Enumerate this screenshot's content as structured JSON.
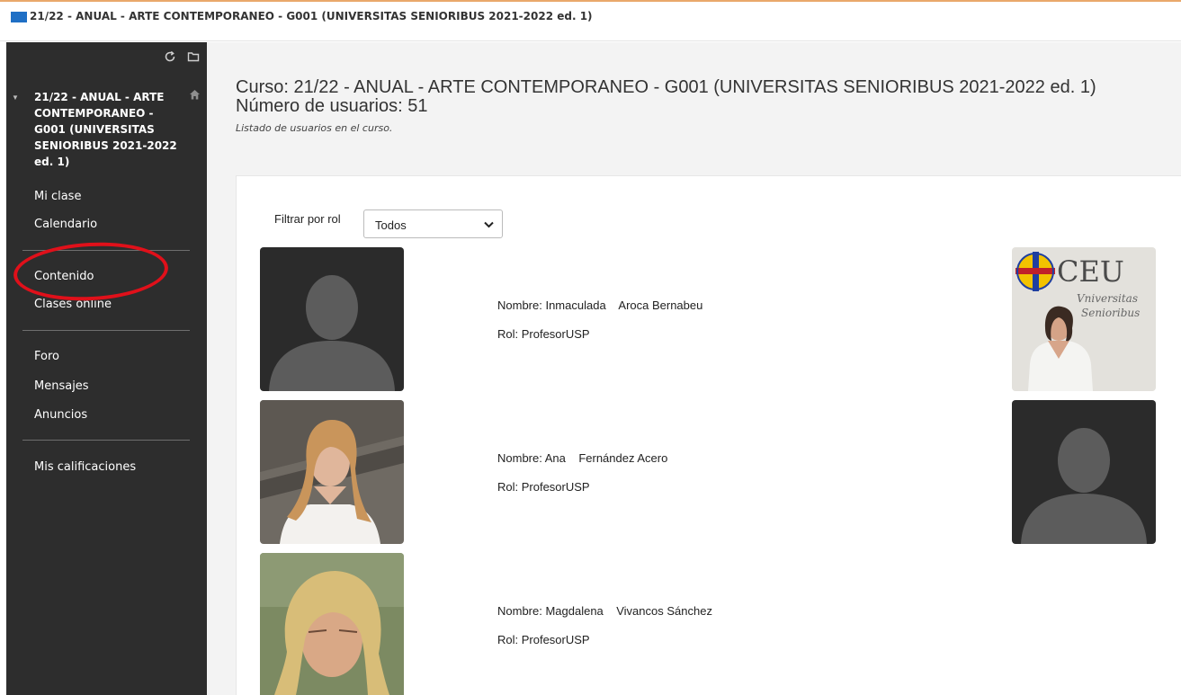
{
  "breadcrumb": "21/22 - ANUAL - ARTE CONTEMPORANEO - G001 (UNIVERSITAS SENIORIBUS 2021-2022 ed. 1)",
  "sidebar": {
    "course_title": "21/22 - ANUAL - ARTE CONTEMPORANEO - G001 (UNIVERSITAS SENIORIBUS 2021-2022 ed. 1)",
    "items": [
      {
        "label": "Mi clase"
      },
      {
        "label": "Calendario"
      },
      {
        "label": "Contenido"
      },
      {
        "label": "Clases online"
      },
      {
        "label": "Foro"
      },
      {
        "label": "Mensajes"
      },
      {
        "label": "Anuncios"
      },
      {
        "label": "Mis calificaciones"
      }
    ],
    "icons": [
      "refresh-icon",
      "folder-icon",
      "home-icon"
    ]
  },
  "main": {
    "course_line": "Curso: 21/22 - ANUAL - ARTE CONTEMPORANEO - G001 (UNIVERSITAS SENIORIBUS 2021-2022 ed. 1)",
    "users_line": "Número de usuarios: 51",
    "description": "Listado de usuarios en el curso.",
    "filter": {
      "label": "Filtrar por rol",
      "selected": "Todos"
    },
    "users": [
      {
        "name": "Nombre: Inmaculada    Aroca Bernabeu",
        "role": "Rol: ProfesorUSP"
      },
      {
        "name": "Nombre: Ana    Fernández Acero",
        "role": "Rol: ProfesorUSP"
      },
      {
        "name": "Nombre: Magdalena    Vivancos Sánchez",
        "role": "Rol: ProfesorUSP"
      }
    ],
    "ceu_badge": {
      "logo": "CEU",
      "line1": "Vniversitas",
      "line2": "Senioribus"
    }
  },
  "colors": {
    "sidebar": "#2d2d2d",
    "accent": "#1f6fc5",
    "highlight": "#e0101a"
  }
}
